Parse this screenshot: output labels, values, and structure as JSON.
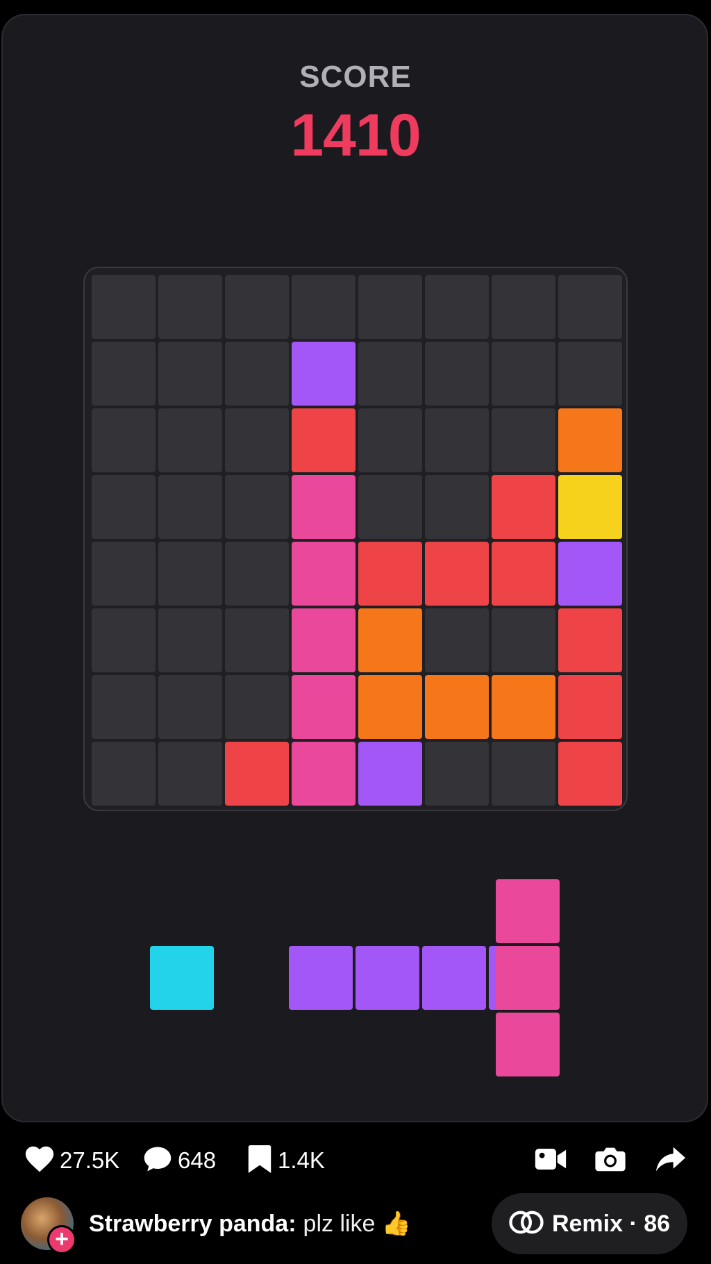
{
  "score": {
    "label": "SCORE",
    "value": "1410"
  },
  "colors": {
    "empty": "#333338",
    "purple": "#a357f6",
    "red": "#ee4447",
    "pink": "#e9489b",
    "orange": "#f6761a",
    "yellow": "#f6d21c",
    "cyan": "#22d3ea"
  },
  "board": {
    "rows": 8,
    "cols": 8,
    "grid": [
      [
        "",
        "",
        "",
        "",
        "",
        "",
        "",
        ""
      ],
      [
        "",
        "",
        "",
        "purple",
        "",
        "",
        "",
        ""
      ],
      [
        "",
        "",
        "",
        "red",
        "",
        "",
        "",
        "orange"
      ],
      [
        "",
        "",
        "",
        "pink",
        "",
        "",
        "red",
        "yellow"
      ],
      [
        "",
        "",
        "",
        "pink",
        "red",
        "red",
        "red",
        "purple"
      ],
      [
        "",
        "",
        "",
        "pink",
        "orange",
        "",
        "",
        "red"
      ],
      [
        "",
        "",
        "",
        "pink",
        "orange",
        "orange",
        "orange",
        "red"
      ],
      [
        "",
        "",
        "red",
        "pink",
        "purple",
        "",
        "",
        "red"
      ]
    ]
  },
  "pieces": [
    {
      "name": "single-block-piece",
      "color": "cyan",
      "cells": [
        [
          0,
          0
        ]
      ]
    },
    {
      "name": "horizontal-line-piece",
      "color": "purple",
      "cells": [
        [
          0,
          0
        ],
        [
          0,
          1
        ],
        [
          0,
          2
        ],
        [
          0,
          3
        ]
      ]
    },
    {
      "name": "vertical-line-piece",
      "color": "pink",
      "cells": [
        [
          0,
          0
        ],
        [
          1,
          0
        ],
        [
          2,
          0
        ]
      ]
    }
  ],
  "social": {
    "likes": "27.5K",
    "comments": "648",
    "saves": "1.4K",
    "icons": [
      "heart-icon",
      "comment-icon",
      "bookmark-icon",
      "video-camera-icon",
      "camera-icon",
      "share-icon"
    ]
  },
  "author": {
    "name": "Strawberry panda:",
    "caption": "plz like 👍"
  },
  "remix": {
    "label": "Remix · 86"
  }
}
